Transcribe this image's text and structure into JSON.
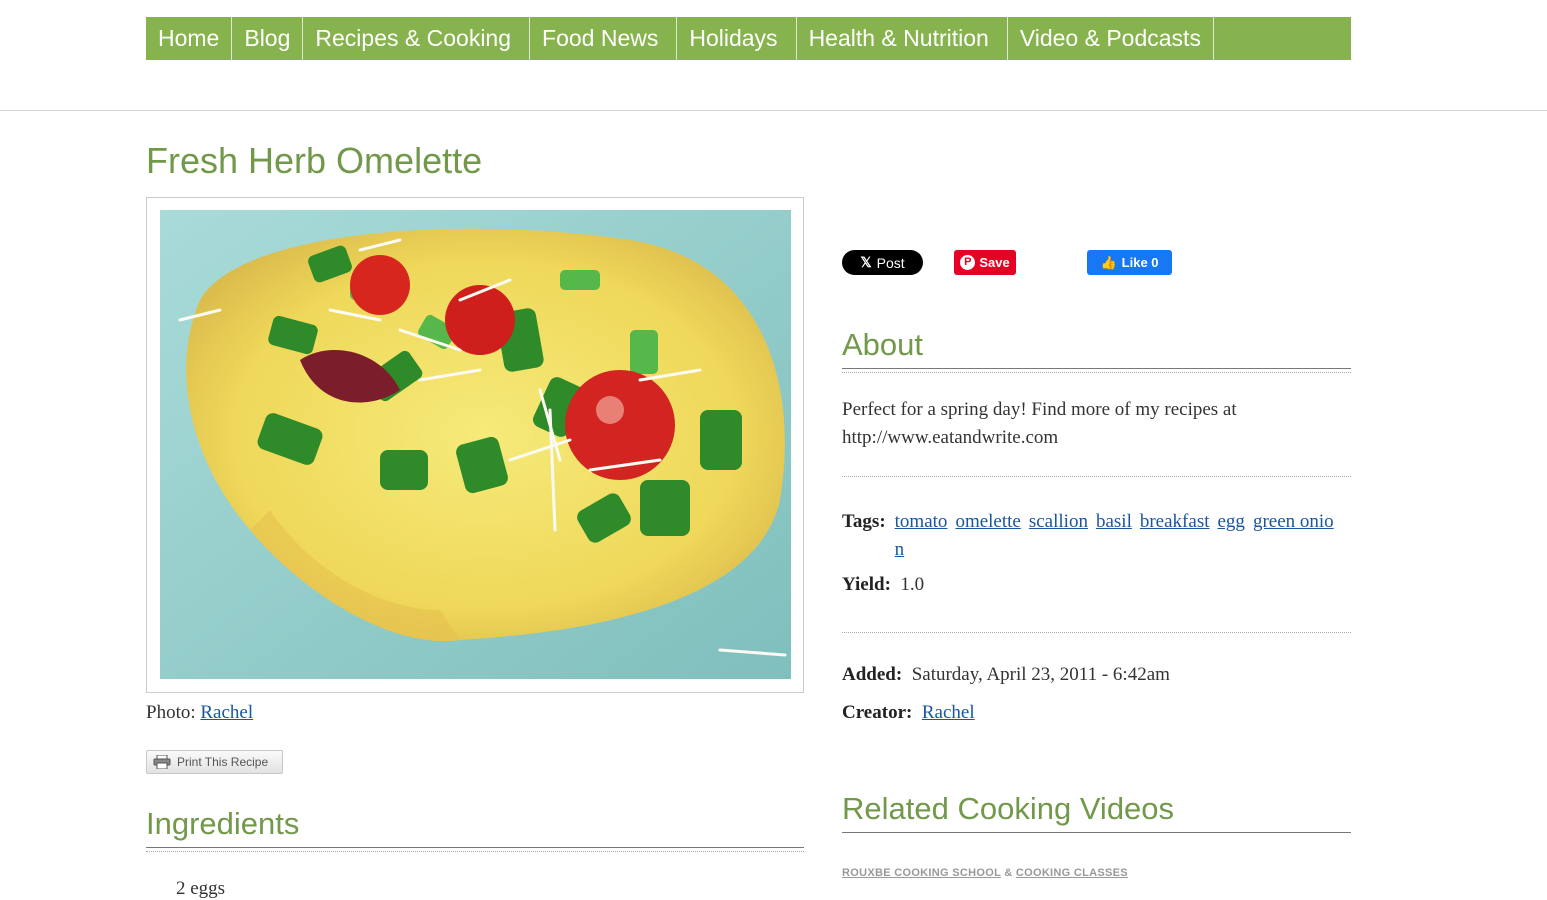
{
  "nav": {
    "items": [
      {
        "label": "Home"
      },
      {
        "label": "Blog"
      },
      {
        "label": "Recipes & Cooking"
      },
      {
        "label": "Food News"
      },
      {
        "label": "Holidays"
      },
      {
        "label": "Health & Nutrition"
      },
      {
        "label": "Video & Podcasts"
      }
    ]
  },
  "recipe": {
    "title": "Fresh Herb Omelette",
    "photo_caption_prefix": "Photo:",
    "photo_credit": "Rachel",
    "print_label": "Print This Recipe",
    "ingredients_heading": "Ingredients",
    "ingredients": [
      "2 eggs"
    ]
  },
  "social": {
    "x_label": "Post",
    "pinterest_label": "Save",
    "facebook_label": "Like 0"
  },
  "about": {
    "heading": "About",
    "text": "Perfect for a spring day! Find more of my recipes at http://www.eatandwrite.com"
  },
  "meta": {
    "tags_label": "Tags:",
    "tags": [
      "tomato",
      "omelette",
      "scallion",
      "basil",
      "breakfast",
      "egg",
      "green onion"
    ],
    "yield_label": "Yield:",
    "yield_value": "1.0",
    "added_label": "Added:",
    "added_value": "Saturday, April 23, 2011 - 6:42am",
    "creator_label": "Creator:",
    "creator_value": "Rachel"
  },
  "related": {
    "heading": "Related Cooking Videos",
    "link1": "Rouxbe Cooking School",
    "separator": "&",
    "link2": "Cooking Classes"
  },
  "colors": {
    "nav_bg": "#86b34d",
    "heading_green": "#72994a",
    "link_blue": "#1a55a0",
    "pinterest_red": "#e60023",
    "facebook_blue": "#1877f2"
  }
}
